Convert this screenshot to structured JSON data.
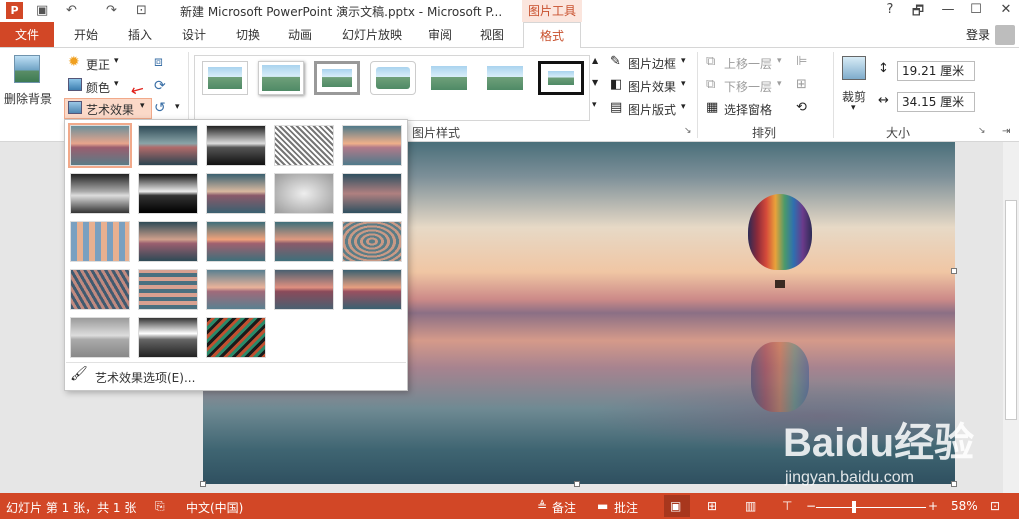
{
  "window": {
    "title": "新建 Microsoft PowerPoint 演示文稿.pptx - Microsoft P...",
    "context_tab": "图片工具",
    "help": "?",
    "restore": "🗗",
    "minimize": "—",
    "maximize": "☐",
    "close": "✕"
  },
  "tabs": [
    "文件",
    "开始",
    "插入",
    "设计",
    "切换",
    "动画",
    "幻灯片放映",
    "审阅",
    "视图",
    "格式"
  ],
  "login": "登录",
  "ribbon": {
    "remove_bg": "删除背景",
    "corrections": "更正",
    "color": "颜色",
    "artistic": "艺术效果",
    "pic_border": "图片边框",
    "pic_effects": "图片效果",
    "pic_layout": "图片版式",
    "group_styles": "图片样式",
    "bring_forward": "上移一层",
    "send_backward": "下移一层",
    "selection_pane": "选择窗格",
    "group_arrange": "排列",
    "crop": "裁剪",
    "height": "19.21 厘米",
    "width": "34.15 厘米",
    "group_size": "大小"
  },
  "dropdown": {
    "options_label": "艺术效果选项(E)..."
  },
  "status": {
    "slide": "幻灯片 第 1 张，共 1 张",
    "language": "中文(中国)",
    "notes": "备注",
    "comments": "批注",
    "zoom": "58%",
    "minus": "−",
    "plus": "+"
  },
  "watermark": {
    "brand": "Baidu经验",
    "url": "jingyan.baidu.com"
  }
}
